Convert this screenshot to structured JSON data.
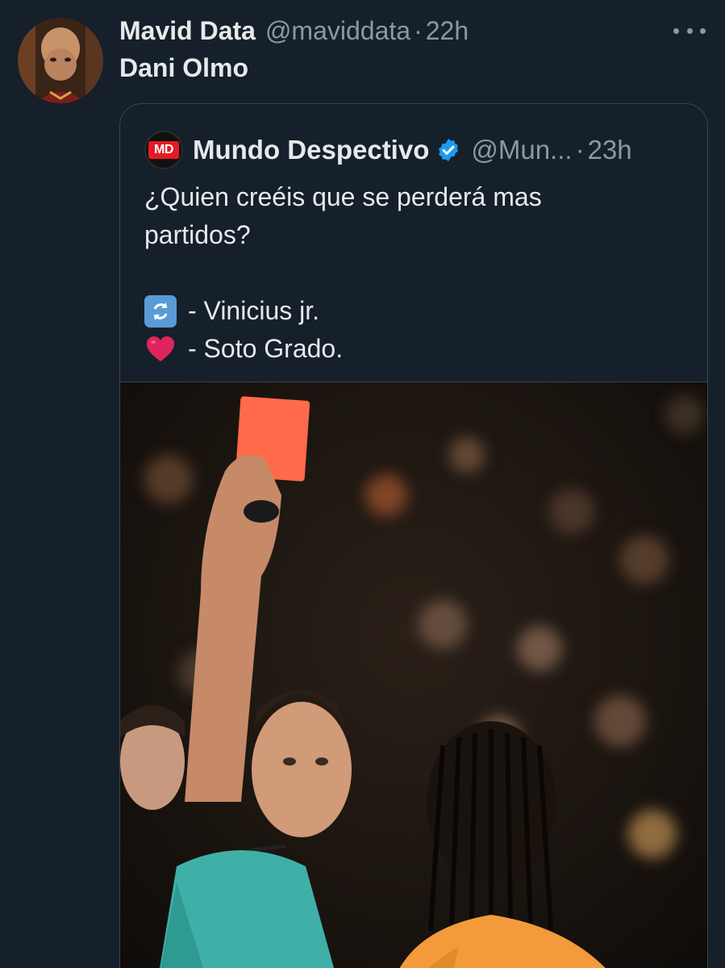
{
  "tweet": {
    "display_name": "Mavid Data",
    "handle": "@maviddata",
    "separator": "·",
    "time": "22h",
    "text": "Dani Olmo",
    "avatar_icon": "user-avatar-photo",
    "more_icon": "more-options-icon"
  },
  "quote": {
    "logo_text": "MD",
    "display_name": "Mundo Despectivo",
    "verified_icon": "verified-badge-icon",
    "handle": "@Mun...",
    "separator": "·",
    "time": "23h",
    "line1": "¿Quien creéis que se perderá mas",
    "line2": "partidos?",
    "option1_icon": "repost-arrows-emoji",
    "option1_text": "- Vinicius jr.",
    "option2_icon": "red-heart-emoji",
    "option2_text": "- Soto Grado.",
    "photo_icon": "referee-red-card-photo"
  },
  "colors": {
    "background": "#15202b",
    "text": "#e7e9ea",
    "muted": "#8b98a5",
    "border": "#38444d",
    "verified": "#1d9bf0",
    "heart": "#e0245e",
    "red_card": "#ff6a4a"
  }
}
